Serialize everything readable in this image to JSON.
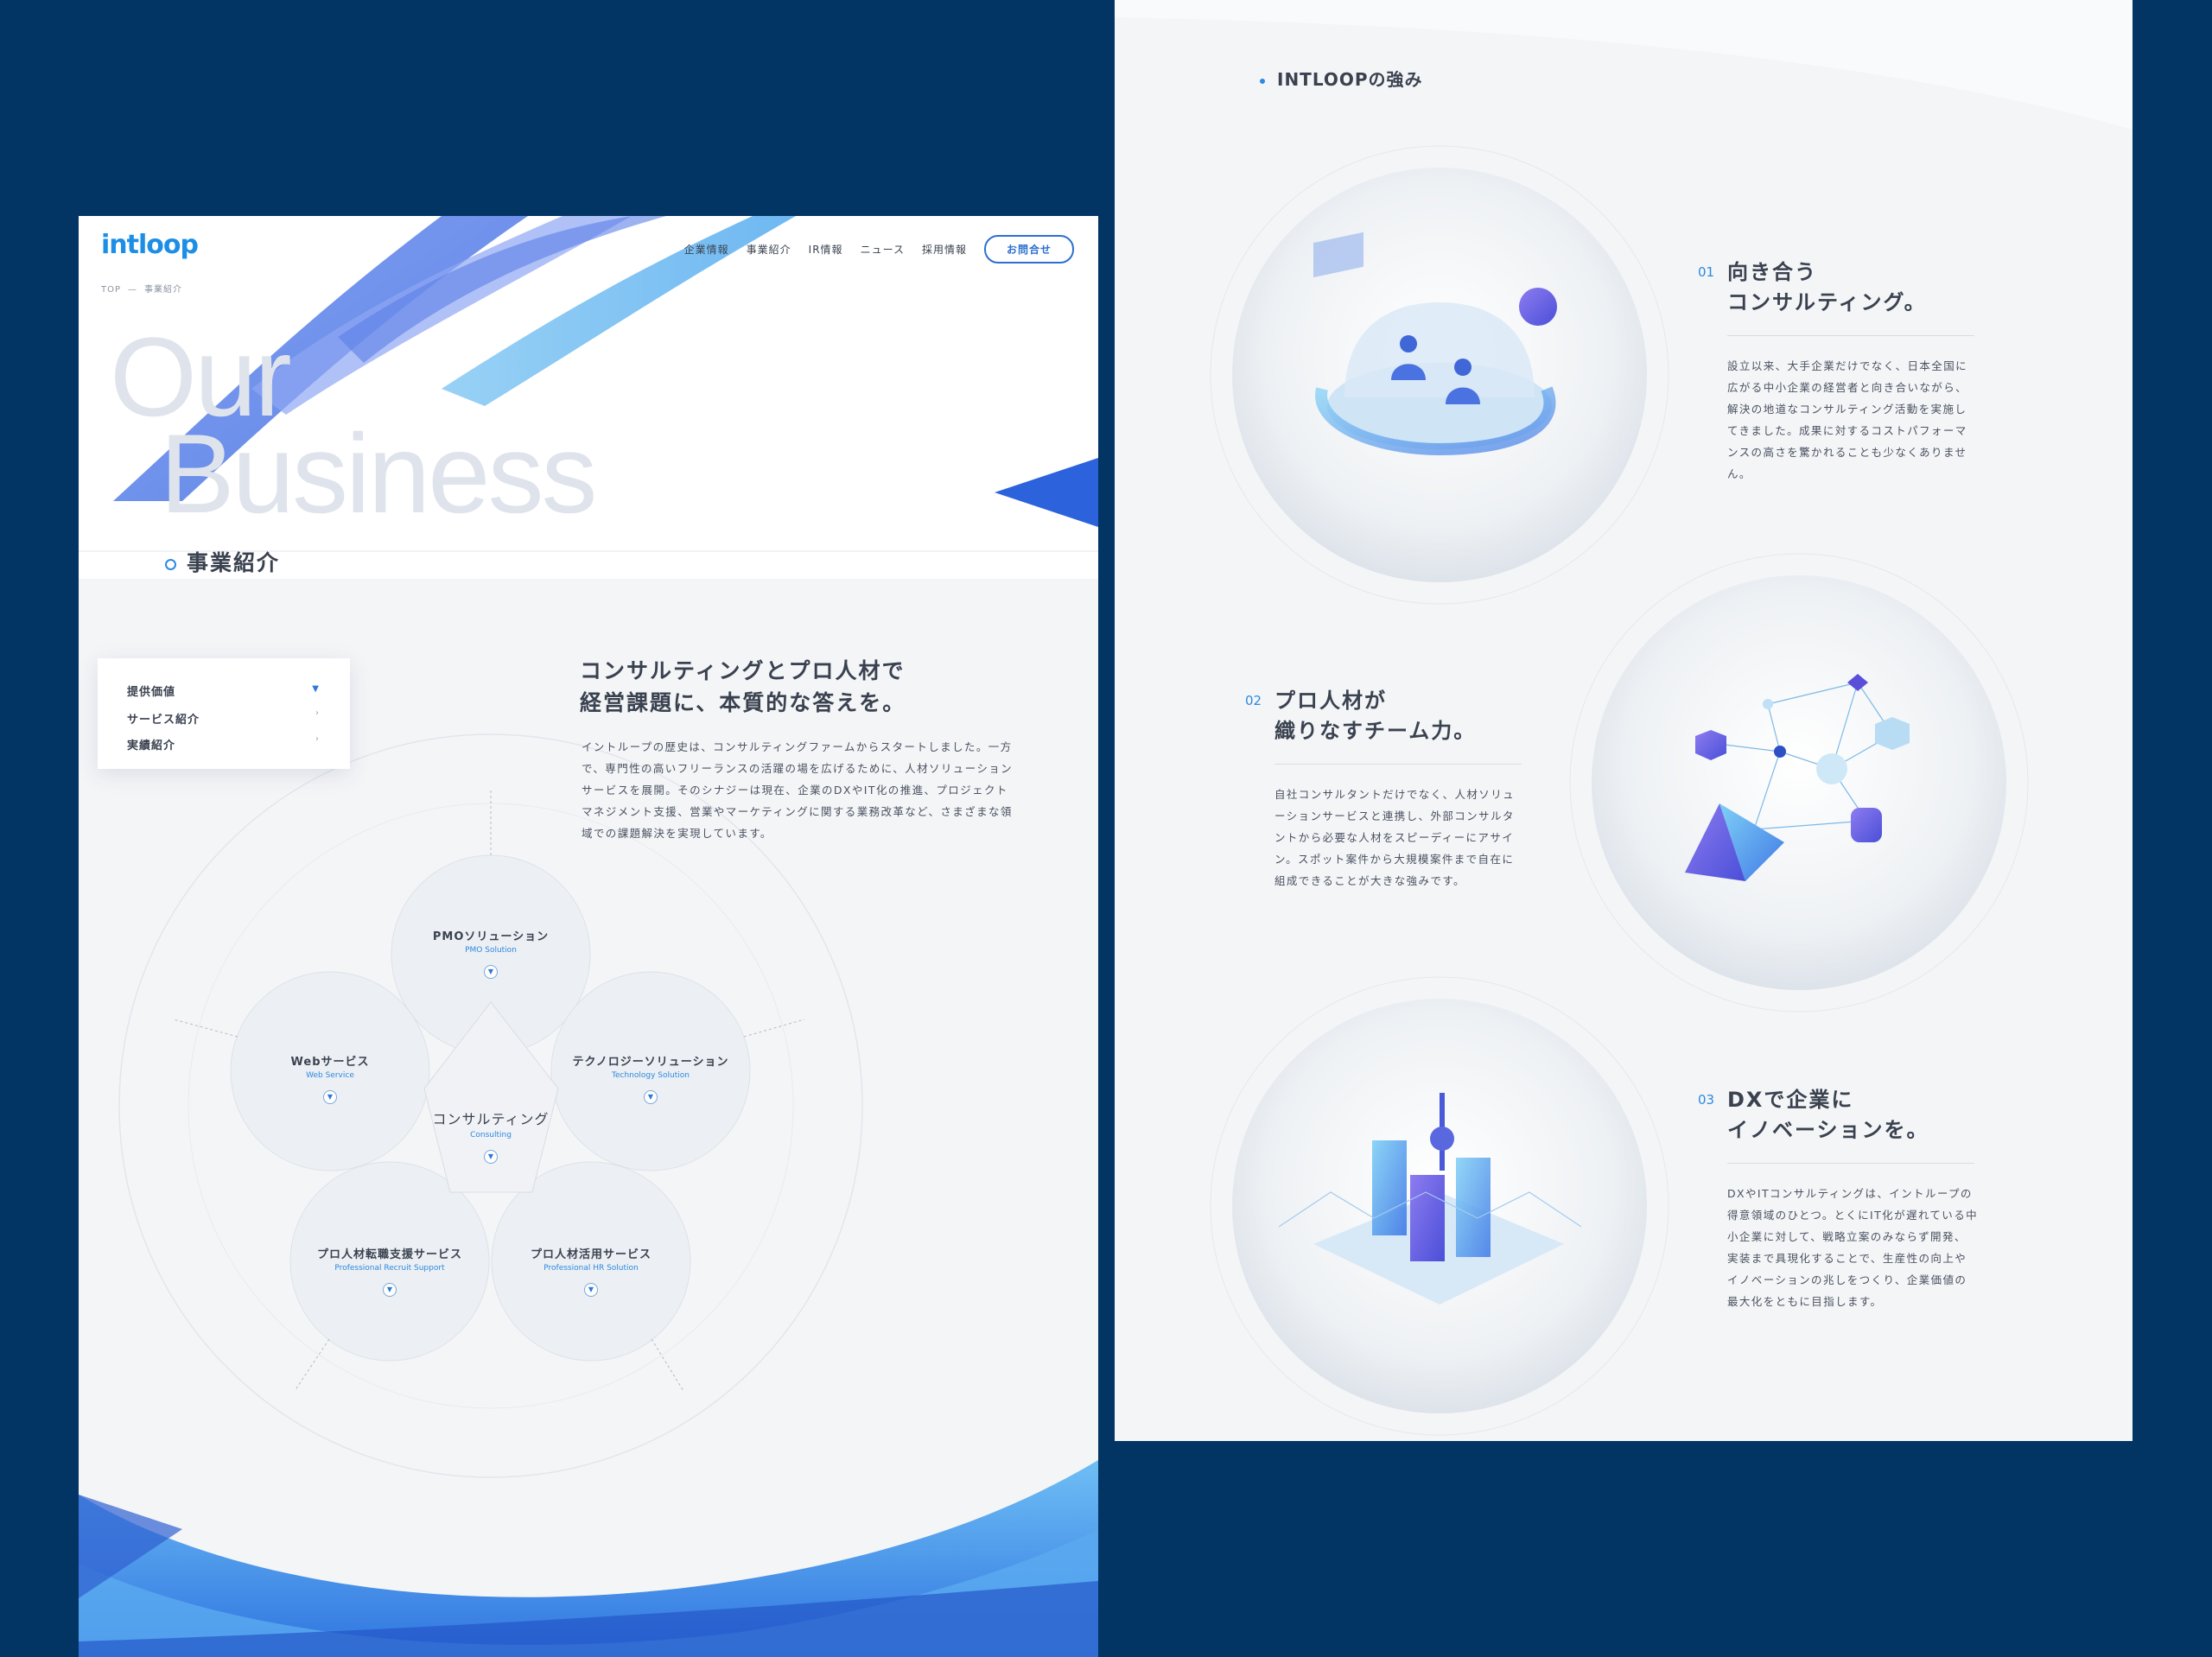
{
  "left": {
    "logo": {
      "a": "int",
      "b": "loop"
    },
    "nav": [
      {
        "label": "企業情報"
      },
      {
        "label": "事業紹介"
      },
      {
        "label": "IR情報"
      },
      {
        "label": "ニュース"
      },
      {
        "label": "採用情報"
      }
    ],
    "contact_label": "お問合せ",
    "breadcrumb": {
      "home": "TOP",
      "sep": "—",
      "current": "事業紹介"
    },
    "big_title": {
      "line1": "Our",
      "line2": "Business"
    },
    "section_label": "事業紹介",
    "subnav": [
      {
        "label": "提供価値",
        "arrow": "▼"
      },
      {
        "label": "サービス紹介",
        "arrow": "›"
      },
      {
        "label": "実績紹介",
        "arrow": "›"
      }
    ],
    "heading": {
      "line1": "コンサルティングとプロ人材で",
      "line2": "経営課題に、本質的な答えを。"
    },
    "lead": "イントループの歴史は、コンサルティングファームからスタートしました。一方で、専門性の高いフリーランスの活躍の場を広げるために、人材ソリューションサービスを展開。そのシナジーは現在、企業のDXやIT化の推進、プロジェクトマネジメント支援、営業やマーケティングに関する業務改革など、さまざまな領域での課題解決を実現しています。",
    "diagram": {
      "center": {
        "title": "コンサルティング",
        "sub": "Consulting",
        "mark": "▼"
      },
      "nodes": [
        {
          "title": "PMOソリューション",
          "sub": "PMO Solution",
          "mark": "▼"
        },
        {
          "title": "Webサービス",
          "sub": "Web Service",
          "mark": "▼"
        },
        {
          "title": "テクノロジーソリューション",
          "sub": "Technology Solution",
          "mark": "▼"
        },
        {
          "title": "プロ人材転職支援サービス",
          "sub": "Professional Recruit Support",
          "mark": "▼"
        },
        {
          "title": "プロ人材活用サービス",
          "sub": "Professional HR Solution",
          "mark": "▼"
        }
      ]
    }
  },
  "right": {
    "section_label": "INTLOOPの強み",
    "features": [
      {
        "num": "01",
        "title1": "向き合う",
        "title2": "コンサルティング。",
        "body": "設立以来、大手企業だけでなく、日本全国に広がる中小企業の経営者と向き合いながら、解決の地道なコンサルティング活動を実施してきました。成果に対するコストパフォーマンスの高さを驚かれることも少なくありません。",
        "icon": "meeting-dome-icon"
      },
      {
        "num": "02",
        "title1": "プロ人材が",
        "title2": "織りなすチーム力。",
        "body": "自社コンサルタントだけでなく、人材ソリューションサービスと連携し、外部コンサルタントから必要な人材をスピーディーにアサイン。スポット案件から大規模案件まで自在に組成できることが大きな強みです。",
        "icon": "network-polyhedra-icon"
      },
      {
        "num": "03",
        "title1": "DXで企業に",
        "title2": "イノベーションを。",
        "body": "DXやITコンサルティングは、イントループの得意領域のひとつ。とくにIT化が遅れている中小企業に対して、戦略立案のみならず開発、実装まで具現化することで、生産性の向上やイノベーションの兆しをつくり、企業価値の最大化をともに目指します。",
        "icon": "smart-city-icon"
      }
    ]
  },
  "colors": {
    "page_bg": "#023564",
    "accent": "#2c8ae0",
    "panel": "#f4f5f7",
    "text": "#3a4250"
  }
}
